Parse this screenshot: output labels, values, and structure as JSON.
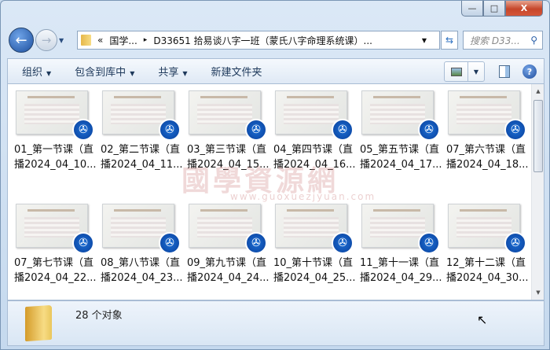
{
  "window": {
    "minimize": "—",
    "maximize": "□",
    "close": "X"
  },
  "address": {
    "prefix": "«",
    "crumbs": [
      "国学...",
      "D33651 拾易谈八字一班（蒙氏八字命理系统课）..."
    ],
    "separator": "▸"
  },
  "search": {
    "placeholder": "搜索 D33..."
  },
  "toolbar": {
    "organize": "组织",
    "include_library": "包含到库中",
    "share": "共享",
    "new_folder": "新建文件夹",
    "help": "?"
  },
  "files": [
    {
      "line1": "01_第一节课（直",
      "line2": "播2024_04_10..."
    },
    {
      "line1": "02_第二节课（直",
      "line2": "播2024_04_11..."
    },
    {
      "line1": "03_第三节课（直",
      "line2": "播2024_04_15..."
    },
    {
      "line1": "04_第四节课（直",
      "line2": "播2024_04_16..."
    },
    {
      "line1": "05_第五节课（直",
      "line2": "播2024_04_17..."
    },
    {
      "line1": "07_第六节课（直",
      "line2": "播2024_04_18..."
    },
    {
      "line1": "07_第七节课（直",
      "line2": "播2024_04_22..."
    },
    {
      "line1": "08_第八节课（直",
      "line2": "播2024_04_23..."
    },
    {
      "line1": "09_第九节课（直",
      "line2": "播2024_04_24..."
    },
    {
      "line1": "10_第十节课（直",
      "line2": "播2024_04_25..."
    },
    {
      "line1": "11_第十一课（直",
      "line2": "播2024_04_29..."
    },
    {
      "line1": "12_第十二课（直",
      "line2": "播2024_04_30..."
    }
  ],
  "file_icon": "video-player-icon",
  "status": {
    "count": "28 个对象"
  },
  "watermark": {
    "text": "國學資源網",
    "url": "www.guoxuezjyuan.com"
  },
  "colors": {
    "accent": "#1b6fd6",
    "close": "#c6462a"
  }
}
